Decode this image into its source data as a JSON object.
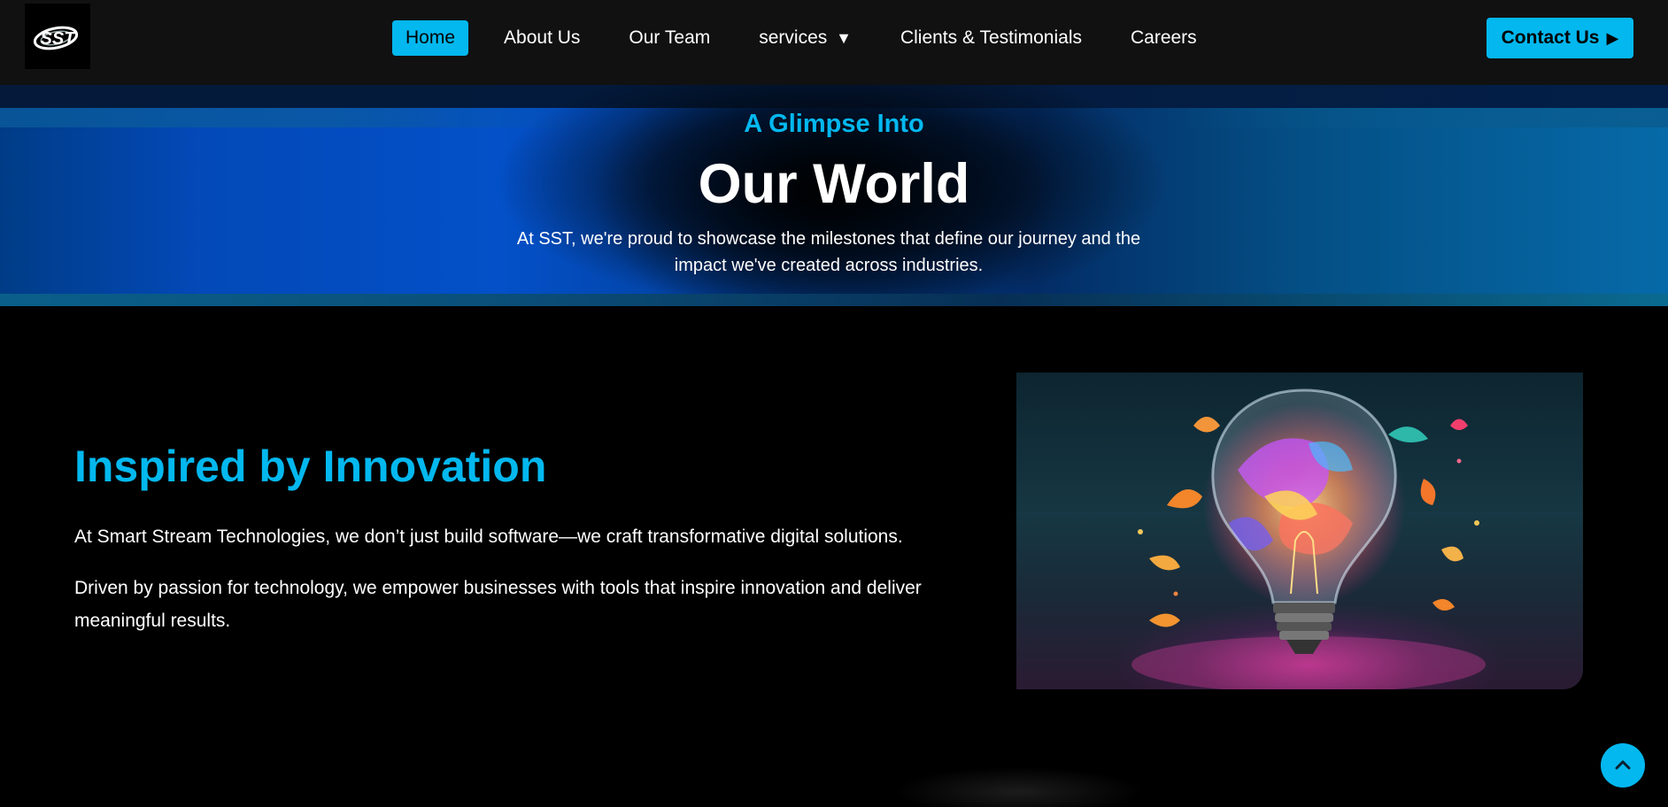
{
  "header": {
    "logo_text": "SST",
    "nav": [
      {
        "label": "Home",
        "active": true
      },
      {
        "label": "About Us"
      },
      {
        "label": "Our Team"
      },
      {
        "label": "services",
        "caret": "▼"
      },
      {
        "label": "Clients & Testimonials"
      },
      {
        "label": "Careers"
      }
    ],
    "contact_label": "Contact Us",
    "contact_icon": "▶"
  },
  "hero": {
    "subtitle": "A Glimpse Into",
    "title": "Our World",
    "description": "At SST, we're proud to showcase the milestones that define our journey and the impact we've created across industries."
  },
  "section": {
    "title": "Inspired by Innovation",
    "paragraph1": "At Smart Stream Technologies, we don’t just build software—we craft transformative digital solutions.",
    "paragraph2": "Driven by passion for technology, we empower businesses with tools that inspire innovation and deliver meaningful results."
  },
  "colors": {
    "accent": "#03b8ef",
    "header_bg": "#111111",
    "page_bg": "#000000"
  },
  "icons": {
    "scroll_top": "chevron-up-icon"
  }
}
